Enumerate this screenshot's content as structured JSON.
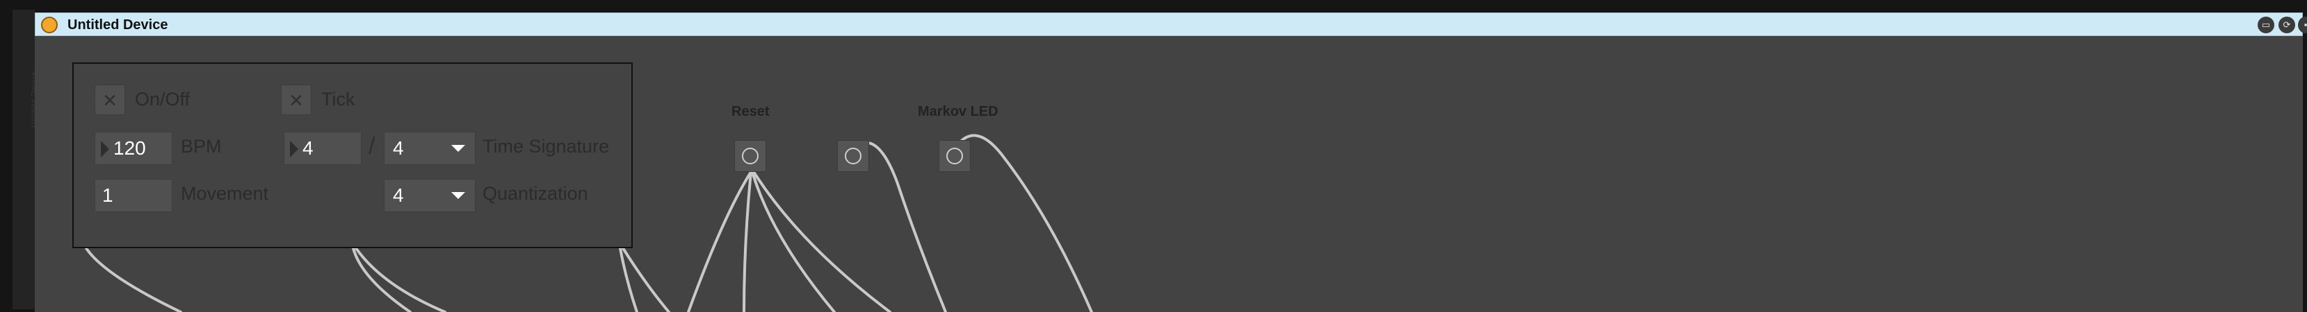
{
  "window": {
    "title": "Untitled Device",
    "status_color": "#f3a72b",
    "title_buttons": [
      "window-icon",
      "hotswap-icon",
      "save-icon"
    ]
  },
  "side_strip": {
    "text": "Untitled Device"
  },
  "panel": {
    "onoff": {
      "label": "On/Off",
      "checked": false
    },
    "tick": {
      "label": "Tick",
      "checked": false
    },
    "bpm": {
      "value": "120",
      "label": "BPM"
    },
    "time_sig": {
      "numerator": "4",
      "slash": "/",
      "denominator": "4",
      "label": "Time Signature"
    },
    "movement": {
      "value": "1",
      "label": "Movement"
    },
    "quantization": {
      "value": "4",
      "label": "Quantization"
    }
  },
  "controls": {
    "reset": {
      "label": "Reset"
    },
    "markov_led": {
      "label": "Markov LED"
    }
  },
  "colors": {
    "background": "#434343",
    "cable": "#c9c9c9",
    "titlebar": "#cfeaf7"
  }
}
